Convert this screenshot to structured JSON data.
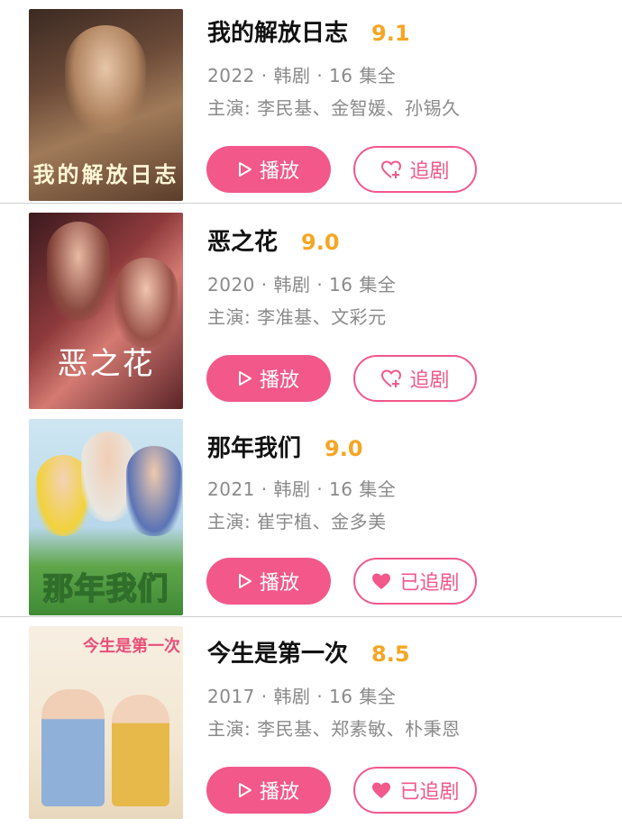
{
  "colors": {
    "accent": "#f2588a",
    "rating": "#f5a623",
    "meta": "#8a8a8a"
  },
  "dramas": [
    {
      "title": "我的解放日志",
      "rating": "9.1",
      "meta": "2022 · 韩剧 · 16 集全",
      "cast": "主演: 李民基、金智媛、孙锡久",
      "play_label": "播放",
      "follow_label": "追剧",
      "followed": false,
      "poster_text": "我的解放日志",
      "follow_icon": "heart-plus-icon"
    },
    {
      "title": "恶之花",
      "rating": "9.0",
      "meta": "2020 · 韩剧 · 16 集全",
      "cast": "主演: 李准基、文彩元",
      "play_label": "播放",
      "follow_label": "追剧",
      "followed": false,
      "poster_text": "恶之花",
      "follow_icon": "heart-plus-icon"
    },
    {
      "title": "那年我们",
      "rating": "9.0",
      "meta": "2021 · 韩剧 · 16 集全",
      "cast": "主演: 崔宇植、金多美",
      "play_label": "播放",
      "follow_label": "已追剧",
      "followed": true,
      "poster_text": "那年我们",
      "follow_icon": "heart-filled-icon"
    },
    {
      "title": "今生是第一次",
      "rating": "8.5",
      "meta": "2017 · 韩剧 · 16 集全",
      "cast": "主演: 李民基、郑素敏、朴秉恩",
      "play_label": "播放",
      "follow_label": "已追剧",
      "followed": true,
      "poster_text": "今生是第一次",
      "follow_icon": "heart-filled-icon"
    }
  ]
}
